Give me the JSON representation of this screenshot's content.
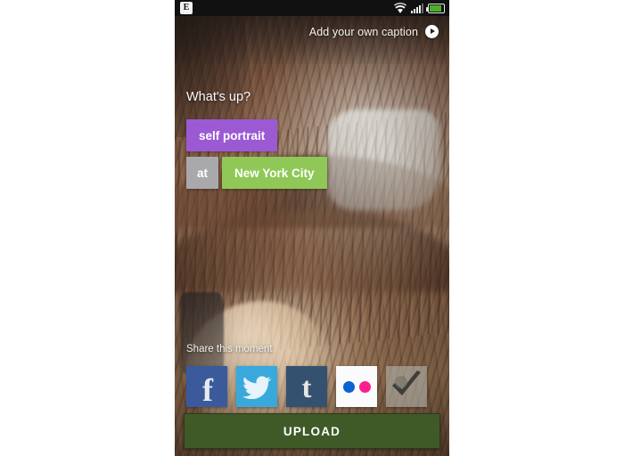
{
  "status_bar": {
    "network_badge": "E",
    "icons": [
      "wifi-icon",
      "signal-icon",
      "battery-icon"
    ],
    "battery_level_pct": 72
  },
  "caption": {
    "label": "Add your own caption",
    "play_icon": "play-icon"
  },
  "prompt": {
    "title": "What's up?"
  },
  "tags": {
    "activity": "self portrait",
    "preposition": "at",
    "place": "New York City"
  },
  "share": {
    "label": "Share this moment",
    "networks": [
      {
        "name": "Facebook",
        "icon": "facebook-icon",
        "glyph": "f",
        "color": "#3a5a9b"
      },
      {
        "name": "Twitter",
        "icon": "twitter-icon",
        "glyph": "",
        "color": "#39a9dd"
      },
      {
        "name": "Tumblr",
        "icon": "tumblr-icon",
        "glyph": "t",
        "color": "#34526f"
      },
      {
        "name": "Flickr",
        "icon": "flickr-icon",
        "glyph": "",
        "color": "#fbfbfb"
      },
      {
        "name": "Foursquare",
        "icon": "check-in-icon",
        "glyph": "",
        "color": "#b0b2ac"
      }
    ]
  },
  "upload": {
    "label": "UPLOAD",
    "color": "#3f5a27"
  },
  "colors": {
    "tag_activity": "#9b5ad4",
    "tag_preposition": "#a9a9ad",
    "tag_place": "#8fc857",
    "upload": "#3f5a27",
    "status_bar": "#111111"
  }
}
